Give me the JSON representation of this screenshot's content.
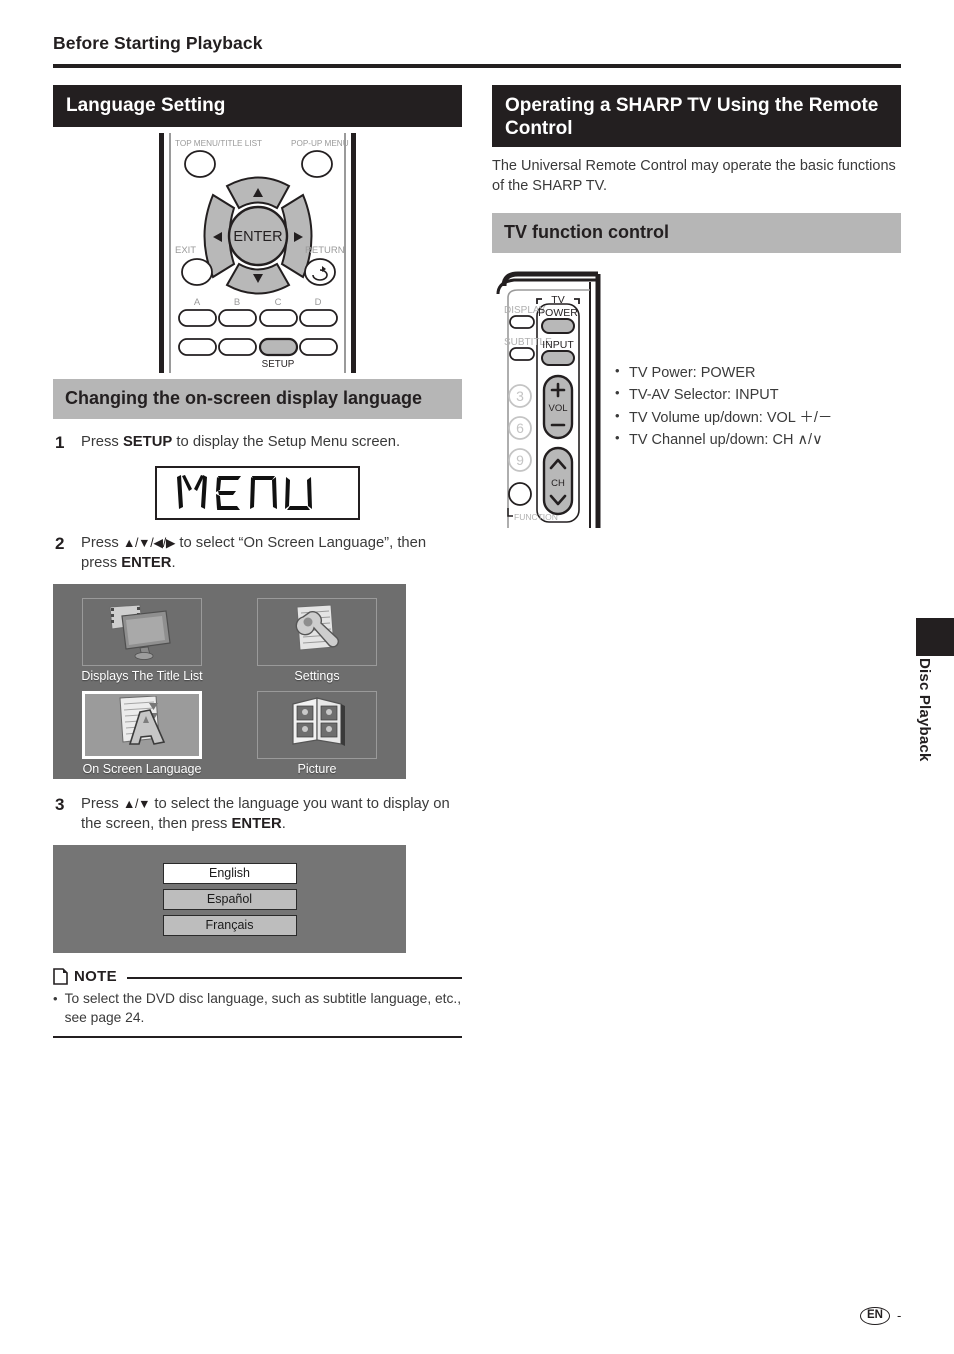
{
  "running_head": "Before Starting Playback",
  "left": {
    "section_title": "Language Setting",
    "remote": {
      "label_top_menu": "TOP MENU/TITLE LIST",
      "label_popup_menu": "POP-UP MENU",
      "label_enter": "ENTER",
      "label_exit": "EXIT",
      "label_return": "RETURN",
      "label_a": "A",
      "label_b": "B",
      "label_c": "C",
      "label_d": "D",
      "label_setup": "SETUP"
    },
    "subsection_title": "Changing the on-screen display language",
    "steps": [
      {
        "num": "1",
        "text_parts": [
          "Press ",
          "SETUP",
          " to display the Setup Menu screen."
        ],
        "plain": "Press SETUP to display the Setup Menu screen."
      },
      {
        "num": "2",
        "plain": "Press ▲/▼/◀/▶ to select “On Screen Language”, then press ENTER."
      },
      {
        "num": "3",
        "plain": "Press ▲/▼ to select the language you want to display on the screen, then press ENTER."
      }
    ],
    "lcd_display": "MENU",
    "setup_menu": {
      "items": [
        {
          "caption": "Displays The Title List",
          "icon": "tv-film-icon",
          "selected": false
        },
        {
          "caption": "Settings",
          "icon": "document-wrench-icon",
          "selected": false
        },
        {
          "caption": "On Screen Language",
          "icon": "document-letter-a-icon",
          "selected": true
        },
        {
          "caption": "Picture",
          "icon": "photo-album-icon",
          "selected": false
        }
      ]
    },
    "language_list": [
      {
        "label": "English",
        "selected": true
      },
      {
        "label": "Español",
        "selected": false
      },
      {
        "label": "Français",
        "selected": false
      }
    ],
    "note": {
      "title": "NOTE",
      "bullet": "To select the DVD disc language, such as subtitle language, etc., see page 24."
    }
  },
  "right": {
    "section_title": "Operating a SHARP TV Using the Remote Control",
    "intro": "The Universal Remote Control may operate the basic functions of the SHARP TV.",
    "subsection_title": "TV function control",
    "remote": {
      "label_tv": "TV",
      "label_display": "DISPLAY",
      "label_subtitle": "SUBTITLE",
      "label_power": "POWER",
      "label_input": "INPUT",
      "label_vol": "VOL",
      "label_ch": "CH",
      "label_plus": "+",
      "label_minus": "−",
      "label_function": "FUNCTION",
      "num_3": "3",
      "num_6": "6",
      "num_9": "9"
    },
    "bullets": [
      "TV Power: POWER",
      "TV-AV Selector: INPUT",
      "TV Volume up/down: VOL ＋/－",
      "TV Channel up/down: CH ∧/∨"
    ]
  },
  "side_tab": "Disc Playback",
  "footer": {
    "lang_code": "EN",
    "page_marker": "-"
  },
  "colors": {
    "bar_black": "#231f20",
    "bar_gray": "#b6b6b6",
    "screen_gray": "#6e6e6e",
    "lang_screen_gray": "#757575",
    "button_gray": "#b8b8b8",
    "text": "#3a3a3a"
  }
}
